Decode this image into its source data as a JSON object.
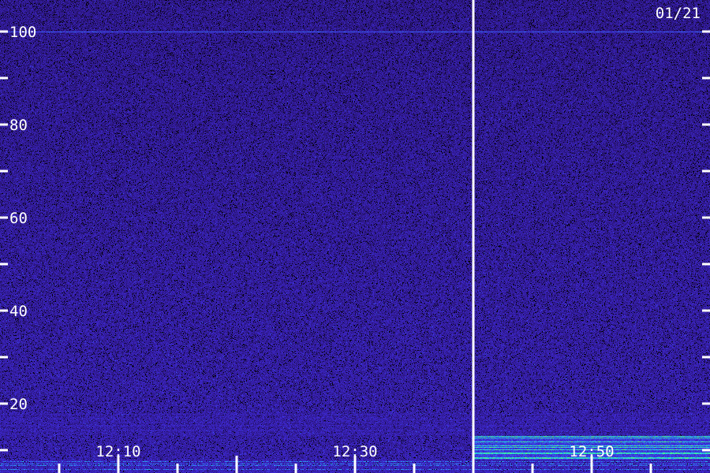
{
  "chart_data": {
    "type": "heatmap",
    "title": "",
    "xlabel": "",
    "ylabel": "",
    "date_label": "01/21",
    "x": {
      "unit": "time (HH:MM)",
      "range": [
        "12:00",
        "12:59"
      ],
      "major_ticks": [
        "12:10",
        "12:30",
        "12:50"
      ],
      "minor_tick_interval_minutes": 5,
      "marker_time": "12:40"
    },
    "y": {
      "range": [
        0,
        100
      ],
      "major_ticks": [
        20,
        40,
        60,
        80,
        100
      ],
      "minor_ticks": [
        10,
        30,
        50,
        70,
        90
      ]
    },
    "colormap": [
      "#000000",
      "#2a1478",
      "#3f2ad8",
      "#2f7cf0",
      "#22d8e0",
      "#60ff60",
      "#ffff40"
    ],
    "features": [
      {
        "kind": "horizontal_line",
        "y": 100,
        "x_range": [
          "12:00",
          "12:59"
        ],
        "intensity": 0.45
      },
      {
        "kind": "band",
        "y_range": [
          0,
          8
        ],
        "x_range": [
          "12:00",
          "12:59"
        ],
        "intensity": 0.55
      },
      {
        "kind": "band",
        "y_range": [
          8,
          13
        ],
        "x_range": [
          "12:40",
          "12:59"
        ],
        "intensity": 0.75
      },
      {
        "kind": "band",
        "y_range": [
          13,
          18
        ],
        "x_range": [
          "12:00",
          "12:59"
        ],
        "intensity": 0.3
      }
    ]
  }
}
